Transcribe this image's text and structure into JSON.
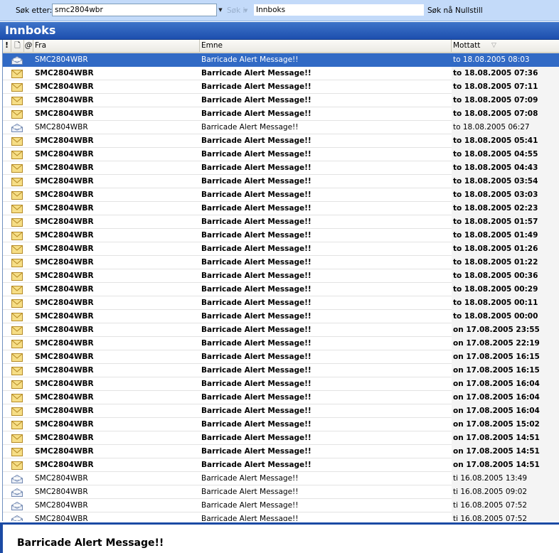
{
  "search": {
    "label": "Søk etter:",
    "value": "smc2804wbr",
    "scope_label": "Søk i",
    "folder_value": "Innboks",
    "search_now": "Søk nå",
    "reset": "Nullstill"
  },
  "folder": {
    "title": "Innboks"
  },
  "columns": {
    "importance": "!",
    "type": "🗋",
    "attachment": "@",
    "from": "Fra",
    "subject": "Emne",
    "received": "Mottatt"
  },
  "icons": {
    "read": "envelope-open-icon",
    "unread": "envelope-closed-icon",
    "sort": "sort-arrow-icon"
  },
  "colors": {
    "selection": "#316ac5",
    "folder_header": "#2a5db8",
    "toolbar": "#c3daf9"
  },
  "messages": [
    {
      "from": "SMC2804WBR",
      "subject": "Barricade Alert Message!!",
      "received": "to 18.08.2005 08:03",
      "unread": false,
      "selected": true
    },
    {
      "from": "SMC2804WBR",
      "subject": "Barricade Alert Message!!",
      "received": "to 18.08.2005 07:36",
      "unread": true
    },
    {
      "from": "SMC2804WBR",
      "subject": "Barricade Alert Message!!",
      "received": "to 18.08.2005 07:11",
      "unread": true
    },
    {
      "from": "SMC2804WBR",
      "subject": "Barricade Alert Message!!",
      "received": "to 18.08.2005 07:09",
      "unread": true
    },
    {
      "from": "SMC2804WBR",
      "subject": "Barricade Alert Message!!",
      "received": "to 18.08.2005 07:08",
      "unread": true
    },
    {
      "from": "SMC2804WBR",
      "subject": "Barricade Alert Message!!",
      "received": "to 18.08.2005 06:27",
      "unread": false
    },
    {
      "from": "SMC2804WBR",
      "subject": "Barricade Alert Message!!",
      "received": "to 18.08.2005 05:41",
      "unread": true
    },
    {
      "from": "SMC2804WBR",
      "subject": "Barricade Alert Message!!",
      "received": "to 18.08.2005 04:55",
      "unread": true
    },
    {
      "from": "SMC2804WBR",
      "subject": "Barricade Alert Message!!",
      "received": "to 18.08.2005 04:43",
      "unread": true
    },
    {
      "from": "SMC2804WBR",
      "subject": "Barricade Alert Message!!",
      "received": "to 18.08.2005 03:54",
      "unread": true
    },
    {
      "from": "SMC2804WBR",
      "subject": "Barricade Alert Message!!",
      "received": "to 18.08.2005 03:03",
      "unread": true
    },
    {
      "from": "SMC2804WBR",
      "subject": "Barricade Alert Message!!",
      "received": "to 18.08.2005 02:23",
      "unread": true
    },
    {
      "from": "SMC2804WBR",
      "subject": "Barricade Alert Message!!",
      "received": "to 18.08.2005 01:57",
      "unread": true
    },
    {
      "from": "SMC2804WBR",
      "subject": "Barricade Alert Message!!",
      "received": "to 18.08.2005 01:49",
      "unread": true
    },
    {
      "from": "SMC2804WBR",
      "subject": "Barricade Alert Message!!",
      "received": "to 18.08.2005 01:26",
      "unread": true
    },
    {
      "from": "SMC2804WBR",
      "subject": "Barricade Alert Message!!",
      "received": "to 18.08.2005 01:22",
      "unread": true
    },
    {
      "from": "SMC2804WBR",
      "subject": "Barricade Alert Message!!",
      "received": "to 18.08.2005 00:36",
      "unread": true
    },
    {
      "from": "SMC2804WBR",
      "subject": "Barricade Alert Message!!",
      "received": "to 18.08.2005 00:29",
      "unread": true
    },
    {
      "from": "SMC2804WBR",
      "subject": "Barricade Alert Message!!",
      "received": "to 18.08.2005 00:11",
      "unread": true
    },
    {
      "from": "SMC2804WBR",
      "subject": "Barricade Alert Message!!",
      "received": "to 18.08.2005 00:00",
      "unread": true
    },
    {
      "from": "SMC2804WBR",
      "subject": "Barricade Alert Message!!",
      "received": "on 17.08.2005 23:55",
      "unread": true
    },
    {
      "from": "SMC2804WBR",
      "subject": "Barricade Alert Message!!",
      "received": "on 17.08.2005 22:19",
      "unread": true
    },
    {
      "from": "SMC2804WBR",
      "subject": "Barricade Alert Message!!",
      "received": "on 17.08.2005 16:15",
      "unread": true
    },
    {
      "from": "SMC2804WBR",
      "subject": "Barricade Alert Message!!",
      "received": "on 17.08.2005 16:15",
      "unread": true
    },
    {
      "from": "SMC2804WBR",
      "subject": "Barricade Alert Message!!",
      "received": "on 17.08.2005 16:04",
      "unread": true
    },
    {
      "from": "SMC2804WBR",
      "subject": "Barricade Alert Message!!",
      "received": "on 17.08.2005 16:04",
      "unread": true
    },
    {
      "from": "SMC2804WBR",
      "subject": "Barricade Alert Message!!",
      "received": "on 17.08.2005 16:04",
      "unread": true
    },
    {
      "from": "SMC2804WBR",
      "subject": "Barricade Alert Message!!",
      "received": "on 17.08.2005 15:02",
      "unread": true
    },
    {
      "from": "SMC2804WBR",
      "subject": "Barricade Alert Message!!",
      "received": "on 17.08.2005 14:51",
      "unread": true
    },
    {
      "from": "SMC2804WBR",
      "subject": "Barricade Alert Message!!",
      "received": "on 17.08.2005 14:51",
      "unread": true
    },
    {
      "from": "SMC2804WBR",
      "subject": "Barricade Alert Message!!",
      "received": "on 17.08.2005 14:51",
      "unread": true
    },
    {
      "from": "SMC2804WBR",
      "subject": "Barricade Alert Message!!",
      "received": "ti 16.08.2005 13:49",
      "unread": false
    },
    {
      "from": "SMC2804WBR",
      "subject": "Barricade Alert Message!!",
      "received": "ti 16.08.2005 09:02",
      "unread": false
    },
    {
      "from": "SMC2804WBR",
      "subject": "Barricade Alert Message!!",
      "received": "ti 16.08.2005 07:52",
      "unread": false
    },
    {
      "from": "SMC2804WBR",
      "subject": "Barricade Alert Message!!",
      "received": "ti 16.08.2005 07:52",
      "unread": false
    }
  ],
  "preview": {
    "subject": "Barricade Alert Message!!"
  }
}
